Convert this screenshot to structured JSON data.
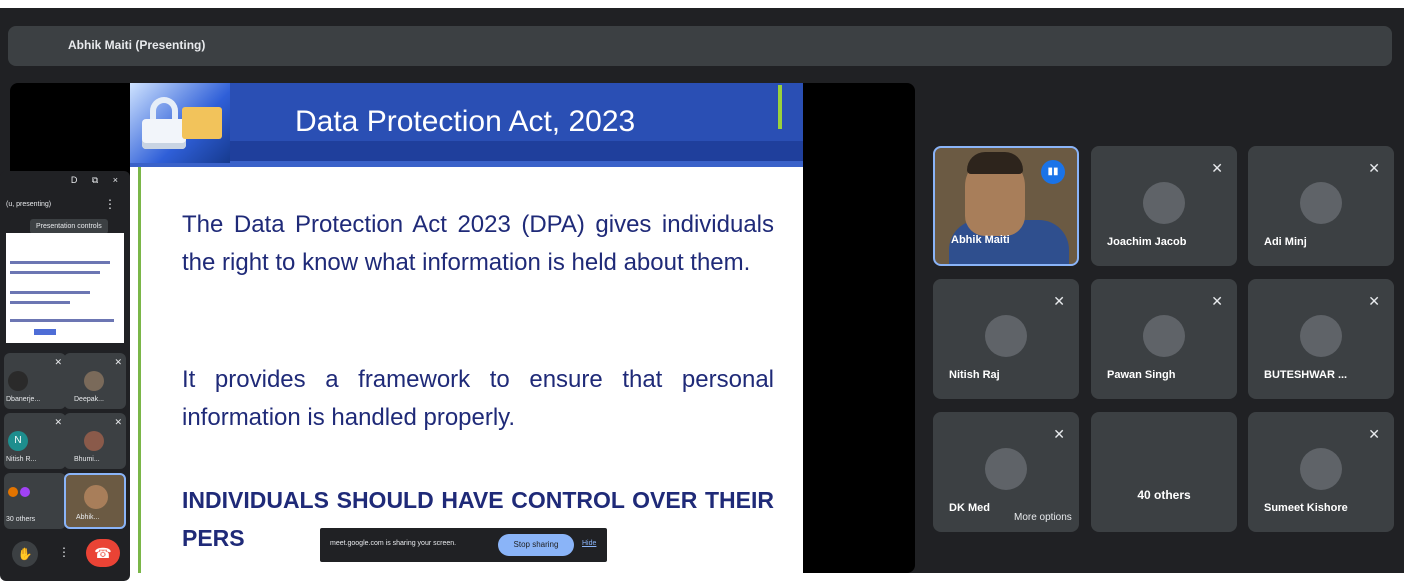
{
  "header": {
    "presenter_title": "Abhik Maiti (Presenting)"
  },
  "slide": {
    "title": "Data Protection Act, 2023",
    "paragraph1": "The Data Protection Act 2023 (DPA) gives individuals the right to know what information is held about them.",
    "paragraph2": "It provides a framework to ensure that personal information is handled properly.",
    "paragraph3": "INDIVIDUALS SHOULD HAVE CONTROL OVER THEIR PERS"
  },
  "pip": {
    "controls": "D ⧉ ×",
    "header": "(u, presenting)",
    "tooltip": "Presentation controls",
    "tiles": [
      {
        "name": "Dbanerje...",
        "color": "#2a2a2a"
      },
      {
        "name": "Deepak...",
        "color": "#7a6a5a"
      },
      {
        "name": "Nitish R...",
        "color": "#1e8e8e",
        "initial": "N"
      },
      {
        "name": "Bhumi...",
        "color": "#8a5a4a"
      },
      {
        "name": "30 others",
        "color": "#e37400"
      },
      {
        "name": "Abhik...",
        "color": "#6b5a43"
      }
    ]
  },
  "share_banner": {
    "message": "meet.google.com is sharing your screen.",
    "stop_label": "Stop sharing",
    "hide_label": "Hide"
  },
  "participants": [
    {
      "name": "Abhik Maiti"
    },
    {
      "name": "Joachim Jacob"
    },
    {
      "name": "Adi Minj"
    },
    {
      "name": "Nitish Raj"
    },
    {
      "name": "Pawan Singh"
    },
    {
      "name": "BUTESHWAR ..."
    },
    {
      "name": "DK Med"
    },
    {
      "name": "40 others"
    },
    {
      "name": "Sumeet Kishore"
    }
  ],
  "more_options_label": "More options",
  "colors": {
    "accent": "#8ab4f8",
    "end_call": "#ea4335",
    "tile_bg": "#3c4043",
    "app_bg": "#202124"
  }
}
